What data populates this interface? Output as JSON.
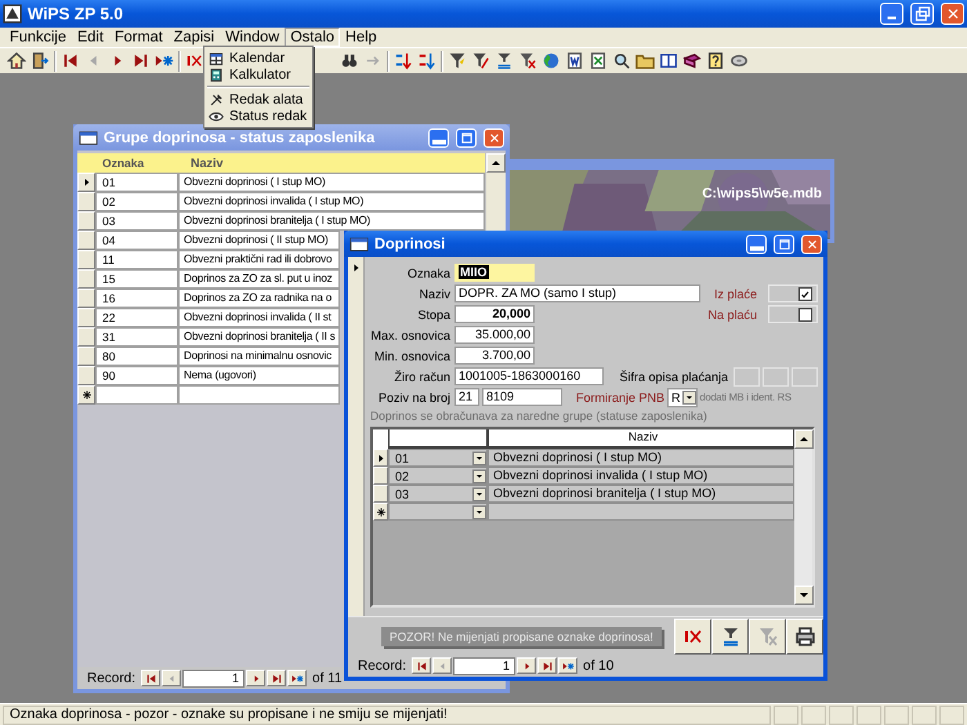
{
  "app": {
    "title": "WiPS ZP 5.0"
  },
  "menu": [
    {
      "label": "Funkcije",
      "selected": false
    },
    {
      "label": "Edit",
      "selected": false
    },
    {
      "label": "Format",
      "selected": false
    },
    {
      "label": "Zapisi",
      "selected": false
    },
    {
      "label": "Window",
      "selected": false
    },
    {
      "label": "Ostalo",
      "selected": true
    },
    {
      "label": "Help",
      "selected": false
    }
  ],
  "dropdown": [
    {
      "kind": "item",
      "label": "Kalendar"
    },
    {
      "kind": "item",
      "label": "Kalkulator"
    },
    {
      "kind": "separator"
    },
    {
      "kind": "item",
      "label": "Redak alata"
    },
    {
      "kind": "item",
      "label": "Status redak"
    }
  ],
  "background_window": {
    "path": "C:\\wips5\\w5e.mdb"
  },
  "grupe": {
    "title": "Grupe doprinosa - status zaposlenika",
    "columns": [
      "Oznaka",
      "Naziv"
    ],
    "rows": [
      {
        "oznaka": "01",
        "naziv": "Obvezni doprinosi ( I stup MO)",
        "selected": true
      },
      {
        "oznaka": "02",
        "naziv": "Obvezni doprinosi invalida ( I stup MO)",
        "selected": false
      },
      {
        "oznaka": "03",
        "naziv": "Obvezni doprinosi branitelja ( I stup MO)",
        "selected": false
      },
      {
        "oznaka": "04",
        "naziv": "Obvezni doprinosi ( II stup MO)",
        "selected": false
      },
      {
        "oznaka": "11",
        "naziv": "Obvezni praktični rad ili dobrovo",
        "selected": false
      },
      {
        "oznaka": "15",
        "naziv": "Doprinos za ZO za sl. put u inoz",
        "selected": false
      },
      {
        "oznaka": "16",
        "naziv": "Doprinos za ZO za radnika na o",
        "selected": false
      },
      {
        "oznaka": "22",
        "naziv": "Obvezni doprinosi invalida ( II st",
        "selected": false
      },
      {
        "oznaka": "31",
        "naziv": "Obvezni doprinosi branitelja ( II s",
        "selected": false
      },
      {
        "oznaka": "80",
        "naziv": "Doprinosi na minimalnu osnovic",
        "selected": false
      },
      {
        "oznaka": "90",
        "naziv": "Nema (ugovori)",
        "selected": false
      }
    ],
    "record": {
      "label": "Record:",
      "current": "1",
      "total": "of 11"
    }
  },
  "doprinosi": {
    "title": "Doprinosi",
    "oznaka": {
      "label": "Oznaka",
      "value": "MIIO"
    },
    "naziv": {
      "label": "Naziv",
      "value": "DOPR. ZA MO (samo I stup)"
    },
    "stopa": {
      "label": "Stopa",
      "value": "20,000"
    },
    "max_osnovica": {
      "label": "Max. osnovica",
      "value": "35.000,00"
    },
    "min_osnovica": {
      "label": "Min. osnovica",
      "value": "3.700,00"
    },
    "ziro_racun": {
      "label": "Žiro račun",
      "value": "1001005-1863000160"
    },
    "poziv_na_broj": {
      "label": "Poziv na broj",
      "model": "21",
      "value": "8109"
    },
    "iz_place": {
      "label": "Iz plaće",
      "checked": true
    },
    "na_placu": {
      "label": "Na plaću",
      "checked": false
    },
    "sifra_opisa": {
      "label": "Šifra opisa plaćanja"
    },
    "formiranje_pnb": {
      "label": "Formiranje PNB",
      "value": "R",
      "hint": "dodati MB i ident. RS"
    },
    "groups_caption": "Doprinos se obračunava za naredne grupe (statuse zaposlenika)",
    "subgrid": {
      "columns": [
        "Naziv"
      ],
      "rows": [
        {
          "code": "01",
          "naziv": "Obvezni doprinosi ( I stup MO)",
          "selected": true
        },
        {
          "code": "02",
          "naziv": "Obvezni doprinosi invalida ( I stup MO)",
          "selected": false
        },
        {
          "code": "03",
          "naziv": "Obvezni doprinosi branitelja ( I stup MO)",
          "selected": false
        }
      ]
    },
    "warning": "POZOR! Ne mijenjati propisane oznake doprinosa!",
    "record": {
      "label": "Record:",
      "current": "1",
      "total": "of 10"
    }
  },
  "status_bar": {
    "text": "Oznaka doprinosa - pozor - oznake su propisane i ne smiju se mijenjati!"
  }
}
